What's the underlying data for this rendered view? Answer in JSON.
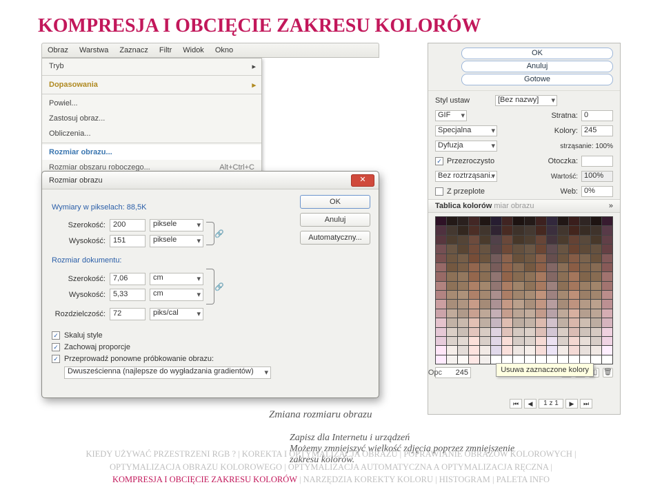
{
  "title": "KOMPRESJA I OBCIĘCIE ZAKRESU KOLORÓW",
  "menu": {
    "items": [
      "Obraz",
      "Warstwa",
      "Zaznacz",
      "Filtr",
      "Widok",
      "Okno"
    ]
  },
  "dropdown": {
    "tryb": "Tryb",
    "dopasowania": "Dopasowania",
    "powiel": "Powiel...",
    "zastosuj": "Zastosuj obraz...",
    "obliczenia": "Obliczenia...",
    "rozmiar_sel": "Rozmiar obrazu...",
    "rozmiar_obszaru": "Rozmiar obszaru roboczego...",
    "shortcut": "Alt+Ctrl+C"
  },
  "dialog": {
    "title": "Rozmiar obrazu",
    "wymiary_label": "Wymiary w pikselach:",
    "wymiary_val": "88,5K",
    "szer_l": "Szerokość:",
    "szer_px": "200",
    "px_unit": "piksele",
    "wys_l": "Wysokość:",
    "wys_px": "151",
    "rozmiar_dok": "Rozmiar dokumentu:",
    "szer_cm": "7,06",
    "wys_cm": "5,33",
    "cm_unit": "cm",
    "roz_l": "Rozdzielczość:",
    "roz_v": "72",
    "roz_unit": "piks/cal",
    "cb1": "Skaluj style",
    "cb2": "Zachowaj proporcje",
    "cb3": "Przeprowadź ponowne próbkowanie obrazu:",
    "resample": "Dwusześcienna (najlepsze do wygładzania gradientów)",
    "ok": "OK",
    "anuluj": "Anuluj",
    "auto": "Automatyczny..."
  },
  "right": {
    "ok": "OK",
    "anuluj": "Anuluj",
    "gotowe": "Gotowe",
    "styl_l": "Styl ustaw",
    "styl_v": "[Bez nazwy]",
    "gif": "GIF",
    "stratna_l": "Stratna:",
    "stratna_v": "0",
    "specjalna": "Specjalna",
    "kolory_l": "Kolory:",
    "kolory_v": "245",
    "dyfuzja": "Dyfuzja",
    "roztrz": "strząsanie: 100%",
    "przez": "Przezroczysto",
    "otoczka": "Otoczka:",
    "bezroz": "Bez roztrząsani..",
    "wartosc_l": "Wartość:",
    "wartosc_v": "100%",
    "zprz": "Z przeplote",
    "web_l": "Web:",
    "web_v": "0%",
    "tablica": "Tablica kolorów",
    "tablica_sub": "miar obrazu",
    "count": "245",
    "tooltip": "Usuwa zaznaczone kolory",
    "opc": "Opc",
    "nav": "1 z 1"
  },
  "caption1": "Zmiana rozmiaru obrazu",
  "caption2_a": "Zapisz dla Internetu i urządzeń",
  "caption2_b": "Możemy zmniejszyć wielkość zdjęcia poprzez zmniejszenie zakresu kolorów.",
  "footer": {
    "l1a": "KIEDY UŻYWAĆ PRZESTRZENI RGB ?",
    "sep": "   |   ",
    "l1b": "KOREKTA I OPTYMALIZACJA OBRAZU",
    "l1c": "POPRAWIANIE OBRAZÓW KOLOROWYCH",
    "l2a": "OPTYMALIZACJA OBRAZU KOLOROWEGO",
    "l2b": "OPTYMALIZACJA AUTOMATYCZNA A OPTYMALIZACJA RĘCZNA",
    "l3a": "KOMPRESJA I OBCIĘCIE ZAKRESU KOLORÓW",
    "l3b": "NARZĘDZIA KOREKTY KOLORU",
    "l3c": "HISTOGRAM",
    "l3d": "PALETA INFO"
  }
}
